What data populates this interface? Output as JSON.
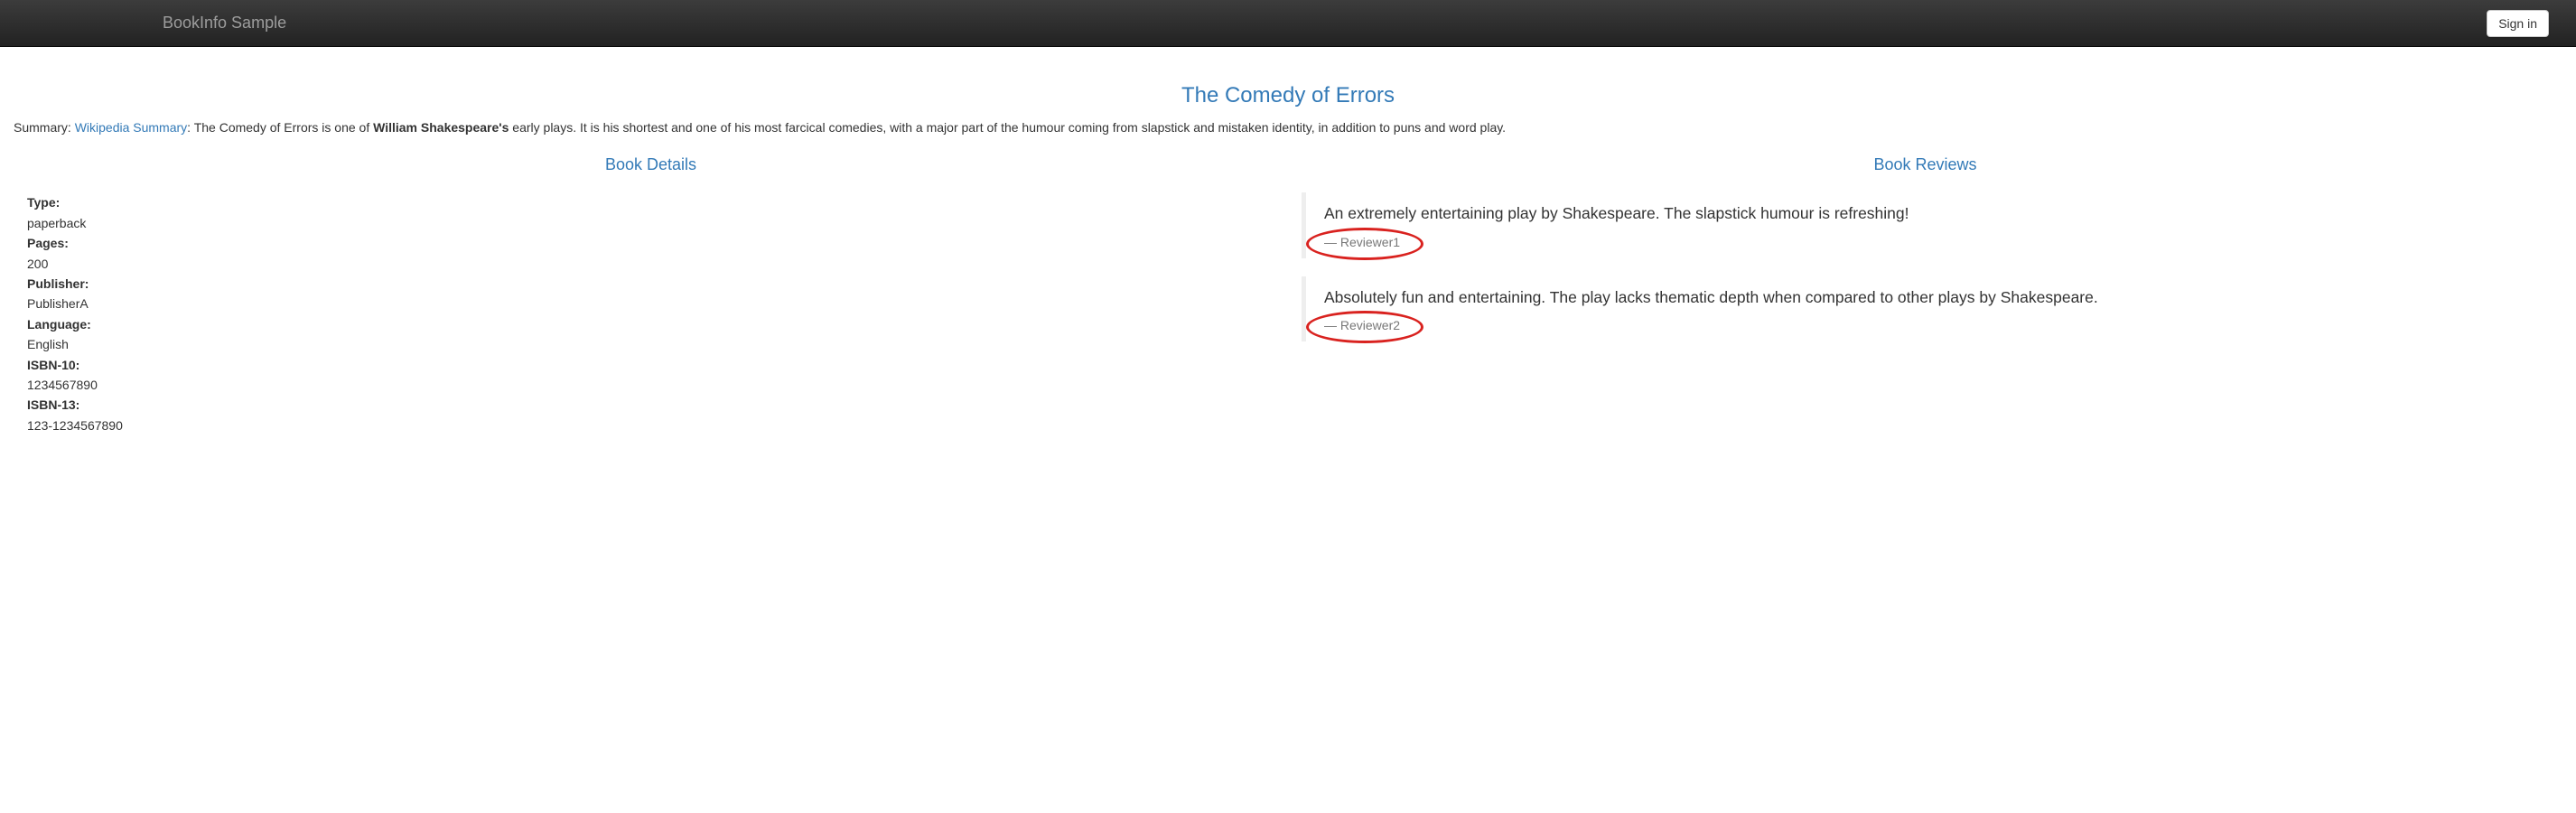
{
  "navbar": {
    "brand": "BookInfo Sample",
    "signin": "Sign in"
  },
  "book": {
    "title": "The Comedy of Errors",
    "summary_prefix": "Summary: ",
    "wikipedia_link_text": "Wikipedia Summary",
    "summary_sep": ": The Comedy of Errors is one of ",
    "author_strong": "William Shakespeare's",
    "summary_rest": " early plays. It is his shortest and one of his most farcical comedies, with a major part of the humour coming from slapstick and mistaken identity, in addition to puns and word play."
  },
  "details": {
    "heading": "Book Details",
    "type_label": "Type:",
    "type_value": "paperback",
    "pages_label": "Pages:",
    "pages_value": "200",
    "publisher_label": "Publisher:",
    "publisher_value": "PublisherA",
    "language_label": "Language:",
    "language_value": "English",
    "isbn10_label": "ISBN-10:",
    "isbn10_value": "1234567890",
    "isbn13_label": "ISBN-13:",
    "isbn13_value": "123-1234567890"
  },
  "reviews": {
    "heading": "Book Reviews",
    "items": [
      {
        "text": "An extremely entertaining play by Shakespeare. The slapstick humour is refreshing!",
        "reviewer": "Reviewer1"
      },
      {
        "text": "Absolutely fun and entertaining. The play lacks thematic depth when compared to other plays by Shakespeare.",
        "reviewer": "Reviewer2"
      }
    ]
  }
}
